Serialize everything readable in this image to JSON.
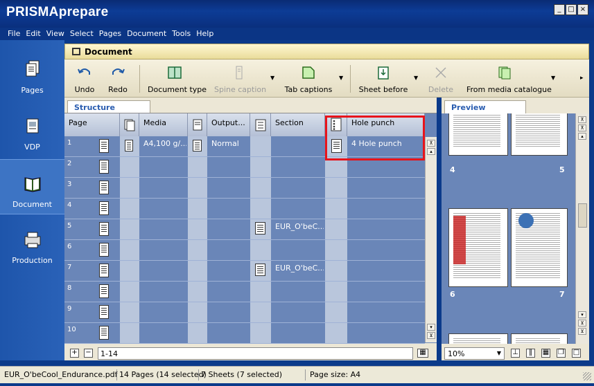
{
  "app": {
    "title": "PRISMAprepare",
    "window_controls": [
      "minimize",
      "maximize",
      "close"
    ]
  },
  "menu": [
    "File",
    "Edit",
    "View",
    "Select",
    "Pages",
    "Document",
    "Tools",
    "Help"
  ],
  "nav": [
    {
      "label": "Pages",
      "icon": "pages-icon"
    },
    {
      "label": "VDP",
      "icon": "vdp-icon"
    },
    {
      "label": "Document",
      "icon": "book-icon",
      "active": true
    },
    {
      "label": "Production",
      "icon": "printer-icon"
    }
  ],
  "panel_title": "Document",
  "toolbar": {
    "undo": "Undo",
    "redo": "Redo",
    "document_type": "Document type",
    "spine_caption": "Spine caption",
    "tab_captions": "Tab captions",
    "sheet_before": "Sheet before",
    "delete": "Delete",
    "from_media_catalogue": "From media catalogue"
  },
  "structure": {
    "tab": "Structure",
    "columns": {
      "page": "Page",
      "media": "Media",
      "output": "Output...",
      "section": "Section",
      "hole_punch": "Hole punch"
    },
    "rows": [
      {
        "page": "1",
        "media": "A4,100 g/...",
        "output": "Normal",
        "section": "",
        "hole_punch": "4 Hole punch"
      },
      {
        "page": "2",
        "media": "",
        "output": "",
        "section": "",
        "hole_punch": ""
      },
      {
        "page": "3",
        "media": "",
        "output": "",
        "section": "",
        "hole_punch": ""
      },
      {
        "page": "4",
        "media": "",
        "output": "",
        "section": "",
        "hole_punch": ""
      },
      {
        "page": "5",
        "media": "",
        "output": "",
        "section": "EUR_O'beC...",
        "hole_punch": ""
      },
      {
        "page": "6",
        "media": "",
        "output": "",
        "section": "",
        "hole_punch": ""
      },
      {
        "page": "7",
        "media": "",
        "output": "",
        "section": "EUR_O'beC...",
        "hole_punch": ""
      },
      {
        "page": "8",
        "media": "",
        "output": "",
        "section": "",
        "hole_punch": ""
      },
      {
        "page": "9",
        "media": "",
        "output": "",
        "section": "",
        "hole_punch": ""
      },
      {
        "page": "10",
        "media": "",
        "output": "",
        "section": "",
        "hole_punch": ""
      }
    ],
    "range": "1-14"
  },
  "preview": {
    "tab": "Preview",
    "thumb_numbers": [
      "4",
      "5",
      "6",
      "7"
    ],
    "zoom": "10%"
  },
  "status": {
    "file": "EUR_O'beCool_Endurance.pdf",
    "pages": "14 Pages (14 selected)",
    "sheets": "7 Sheets (7 selected)",
    "page_size": "Page size: A4"
  },
  "colors": {
    "grid_bg": "#6a86b8",
    "highlight": "#e8141b",
    "title_bar": "#0d3c96"
  }
}
